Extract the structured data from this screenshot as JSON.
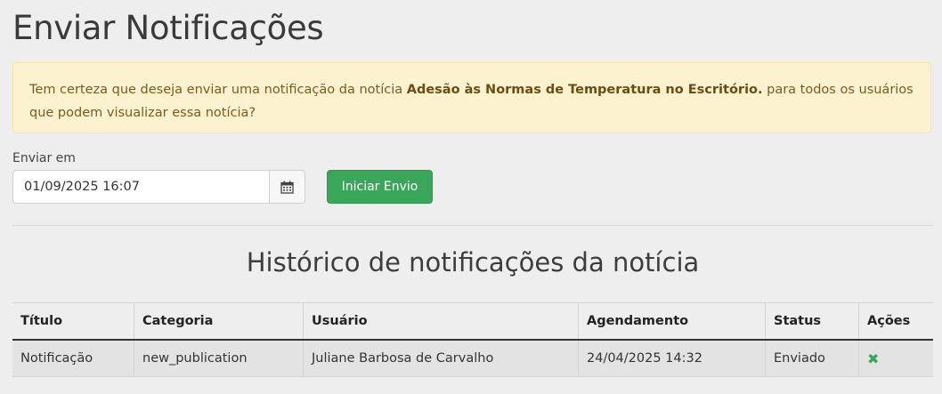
{
  "page": {
    "title": "Enviar Notificações"
  },
  "alert": {
    "text_before": "Tem certeza que deseja enviar uma notificação da notícia ",
    "news_title": "Adesão às Normas de Temperatura no Escritório.",
    "text_after": " para todos os usuários que podem visualizar essa notícia?"
  },
  "form": {
    "send_at_label": "Enviar em",
    "send_at_value": "01/09/2025 16:07",
    "calendar_icon": "calendar-icon",
    "submit_label": "Iniciar Envio"
  },
  "history": {
    "title": "Histórico de notificações da notícia",
    "columns": [
      "Título",
      "Categoria",
      "Usuário",
      "Agendamento",
      "Status",
      "Ações"
    ],
    "rows": [
      {
        "title": "Notificação",
        "category": "new_publication",
        "user": "Juliane Barbosa de Carvalho",
        "schedule": "24/04/2025 14:32",
        "status": "Enviado",
        "action_icon": "remove-icon"
      }
    ]
  },
  "colors": {
    "background": "#eeeeee",
    "alert_bg": "#fdf2d0",
    "alert_text": "#7a5a1e",
    "button_green": "#3aa65a"
  }
}
